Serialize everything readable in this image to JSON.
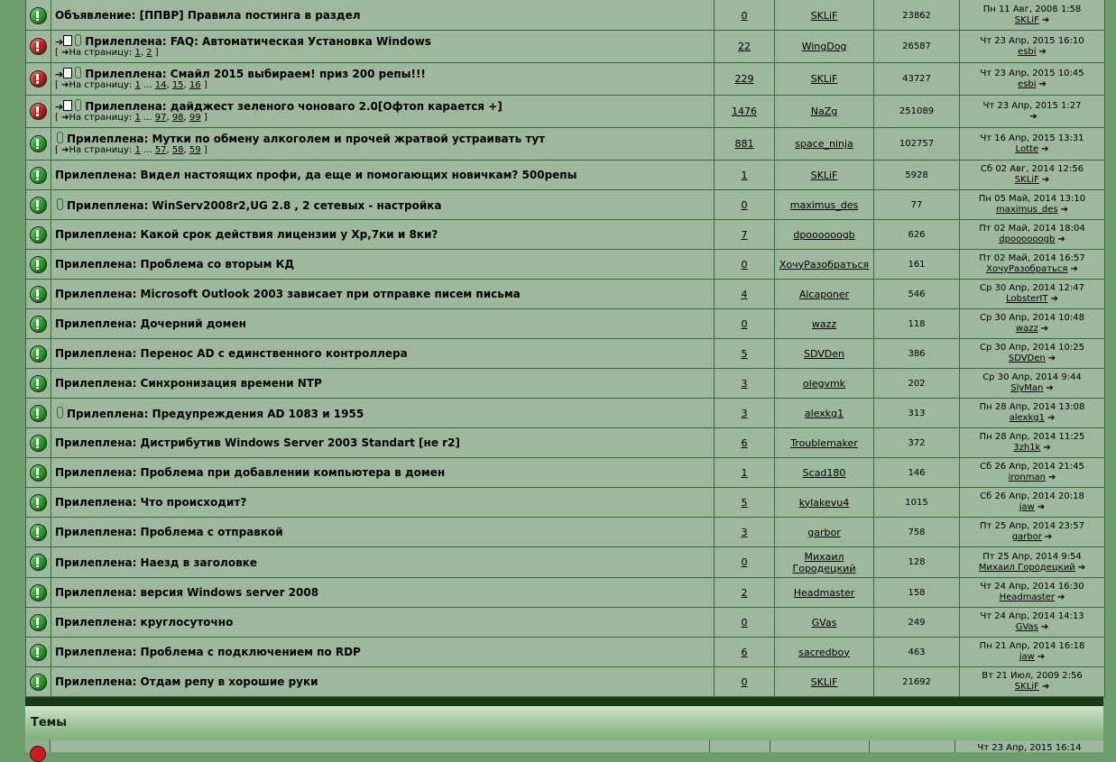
{
  "topics": [
    {
      "status": "green",
      "prefix": "",
      "attach": false,
      "arrow": false,
      "title": "Объявление: [ППВР] Правила постинга в раздел",
      "pages": null,
      "replies": "0",
      "author": "SKLiF",
      "views": "23862",
      "last_date": "Пн 11 Авг, 2008 1:58",
      "last_user": "SKLiF"
    },
    {
      "status": "red",
      "prefix": "new",
      "attach": true,
      "arrow": true,
      "title": "Прилеплена: FAQ: Автоматическая Установка Windows",
      "pages": {
        "label": "На страницу:",
        "links": [
          "1",
          "2"
        ],
        "ellipsis": false
      },
      "replies": "22",
      "author": "WingDog",
      "views": "26587",
      "last_date": "Чт 23 Апр, 2015 16:10",
      "last_user": "esbi"
    },
    {
      "status": "red",
      "prefix": "new",
      "attach": true,
      "arrow": true,
      "title": "Прилеплена: Смайл 2015 выбираем! приз 200 репы!!!",
      "pages": {
        "label": "На страницу:",
        "links": [
          "1",
          "14",
          "15",
          "16"
        ],
        "ellipsis": true
      },
      "replies": "229",
      "author": "SKLiF",
      "views": "43727",
      "last_date": "Чт 23 Апр, 2015 10:45",
      "last_user": "esbi"
    },
    {
      "status": "red",
      "prefix": "new",
      "attach": true,
      "arrow": true,
      "title": "Прилеплена: дайджест зеленого чоноваго 2.0[Офтоп карается +]",
      "pages": {
        "label": "На страницу:",
        "links": [
          "1",
          "97",
          "98",
          "99"
        ],
        "ellipsis": true
      },
      "replies": "1476",
      "author": "NaZg",
      "views": "251089",
      "last_date": "Чт 23 Апр, 2015 1:27",
      "last_user": ""
    },
    {
      "status": "green",
      "prefix": "",
      "attach": true,
      "arrow": false,
      "title": "Прилеплена: Мутки по обмену алкоголем и прочей жратвой устраивать тут",
      "pages": {
        "label": "На страницу:",
        "links": [
          "1",
          "57",
          "58",
          "59"
        ],
        "ellipsis": true
      },
      "replies": "881",
      "author": "space_ninja",
      "views": "102757",
      "last_date": "Чт 16 Апр, 2015 13:31",
      "last_user": "Lotte"
    },
    {
      "status": "green",
      "prefix": "",
      "attach": false,
      "arrow": false,
      "title": "Прилеплена: Видел настоящих профи, да еще и помогающих новичкам? 500репы",
      "pages": null,
      "replies": "1",
      "author": "SKLiF",
      "views": "5928",
      "last_date": "Сб 02 Авг, 2014 12:56",
      "last_user": "SKLiF"
    },
    {
      "status": "green",
      "prefix": "",
      "attach": true,
      "arrow": false,
      "title": "Прилеплена: WinServ2008r2,UG 2.8 , 2 сетевых - настройка",
      "pages": null,
      "replies": "0",
      "author": "maximus_des",
      "views": "77",
      "last_date": "Пн 05 Май, 2014 13:10",
      "last_user": "maximus_des"
    },
    {
      "status": "green",
      "prefix": "",
      "attach": false,
      "arrow": false,
      "title": "Прилеплена: Какой срок действия лицензии у Xp,7ки и 8ки?",
      "pages": null,
      "replies": "7",
      "author": "dpoooooogb",
      "views": "626",
      "last_date": "Пт 02 Май, 2014 18:04",
      "last_user": "dpoooooogb"
    },
    {
      "status": "green",
      "prefix": "",
      "attach": false,
      "arrow": false,
      "title": "Прилеплена: Проблема со вторым КД",
      "pages": null,
      "replies": "0",
      "author": "ХочуРазобраться",
      "views": "161",
      "last_date": "Пт 02 Май, 2014 16:57",
      "last_user": "ХочуРазобраться"
    },
    {
      "status": "green",
      "prefix": "",
      "attach": false,
      "arrow": false,
      "title": "Прилеплена: Microsoft Outlook 2003 зависает при отправке писем письма",
      "pages": null,
      "replies": "4",
      "author": "Alcaponer",
      "views": "546",
      "last_date": "Ср 30 Апр, 2014 12:47",
      "last_user": "LobsterIT"
    },
    {
      "status": "green",
      "prefix": "",
      "attach": false,
      "arrow": false,
      "title": "Прилеплена: Дочерний домен",
      "pages": null,
      "replies": "0",
      "author": "wazz",
      "views": "118",
      "last_date": "Ср 30 Апр, 2014 10:48",
      "last_user": "wazz"
    },
    {
      "status": "green",
      "prefix": "",
      "attach": false,
      "arrow": false,
      "title": "Прилеплена: Перенос AD с единственного контроллера",
      "pages": null,
      "replies": "5",
      "author": "SDVDen",
      "views": "386",
      "last_date": "Ср 30 Апр, 2014 10:25",
      "last_user": "SDVDen"
    },
    {
      "status": "green",
      "prefix": "",
      "attach": false,
      "arrow": false,
      "title": "Прилеплена: Синхронизация времени NTP",
      "pages": null,
      "replies": "3",
      "author": "olegvmk",
      "views": "202",
      "last_date": "Ср 30 Апр, 2014 9:44",
      "last_user": "SlyMan"
    },
    {
      "status": "green",
      "prefix": "",
      "attach": true,
      "arrow": false,
      "title": "Прилеплена: Предупреждения AD 1083 и 1955",
      "pages": null,
      "replies": "3",
      "author": "alexkg1",
      "views": "313",
      "last_date": "Пн 28 Апр, 2014 13:08",
      "last_user": "alexkg1"
    },
    {
      "status": "green",
      "prefix": "",
      "attach": false,
      "arrow": false,
      "title": "Прилеплена: Дистрибутив Windows Server 2003 Standart [не r2]",
      "pages": null,
      "replies": "6",
      "author": "Troublemaker",
      "views": "372",
      "last_date": "Пн 28 Апр, 2014 11:25",
      "last_user": "3zh1k"
    },
    {
      "status": "green",
      "prefix": "",
      "attach": false,
      "arrow": false,
      "title": "Прилеплена: Проблема при добавлении компьютера в домен",
      "pages": null,
      "replies": "1",
      "author": "Scad180",
      "views": "146",
      "last_date": "Сб 26 Апр, 2014 21:45",
      "last_user": "ironman"
    },
    {
      "status": "green",
      "prefix": "",
      "attach": false,
      "arrow": false,
      "title": "Прилеплена: Что происходит?",
      "pages": null,
      "replies": "5",
      "author": "kylakevu4",
      "views": "1015",
      "last_date": "Сб 26 Апр, 2014 20:18",
      "last_user": "jaw"
    },
    {
      "status": "green",
      "prefix": "",
      "attach": false,
      "arrow": false,
      "title": "Прилеплена: Проблема с отправкой",
      "pages": null,
      "replies": "3",
      "author": "garbor",
      "views": "758",
      "last_date": "Пт 25 Апр, 2014 23:57",
      "last_user": "garbor"
    },
    {
      "status": "green",
      "prefix": "",
      "attach": false,
      "arrow": false,
      "title": "Прилеплена: Наезд в заголовке",
      "pages": null,
      "replies": "0",
      "author": "Михаил Городецкий",
      "views": "128",
      "last_date": "Пт 25 Апр, 2014 9:54",
      "last_user": "Михаил Городецкий"
    },
    {
      "status": "green",
      "prefix": "",
      "attach": false,
      "arrow": false,
      "title": "Прилеплена: версия Windows server 2008",
      "pages": null,
      "replies": "2",
      "author": "Headmaster",
      "views": "158",
      "last_date": "Чт 24 Апр, 2014 16:30",
      "last_user": "Headmaster"
    },
    {
      "status": "green",
      "prefix": "",
      "attach": false,
      "arrow": false,
      "title": "Прилеплена: круглосуточно",
      "pages": null,
      "replies": "0",
      "author": "GVas",
      "views": "249",
      "last_date": "Чт 24 Апр, 2014 14:13",
      "last_user": "GVas"
    },
    {
      "status": "green",
      "prefix": "",
      "attach": false,
      "arrow": false,
      "title": "Прилеплена: Проблема с подключением по RDP",
      "pages": null,
      "replies": "6",
      "author": "sacredboy",
      "views": "463",
      "last_date": "Пн 21 Апр, 2014 16:18",
      "last_user": "jaw"
    },
    {
      "status": "green",
      "prefix": "",
      "attach": false,
      "arrow": false,
      "title": "Прилеплена: Отдам репу в хорошие руки",
      "pages": null,
      "replies": "0",
      "author": "SKLiF",
      "views": "21692",
      "last_date": "Вт 21 Июл, 2009 2:56",
      "last_user": "SKLiF"
    }
  ],
  "section": {
    "title": "Темы"
  },
  "partial_row": {
    "last_date": "Чт 23 Апр, 2015 16:14"
  },
  "colors": {
    "page_bg": "#6c9f6c",
    "row_bg": "#9db89d",
    "border": "#3b6b3b",
    "green_status": "#1fa81f",
    "red_status": "#d11a1a"
  },
  "icons": {
    "status_green": "exclamation-green-icon",
    "status_red": "exclamation-red-icon",
    "attach": "paperclip-icon",
    "latest": "view-latest-post-icon",
    "goto": "go-to-page-icon"
  }
}
